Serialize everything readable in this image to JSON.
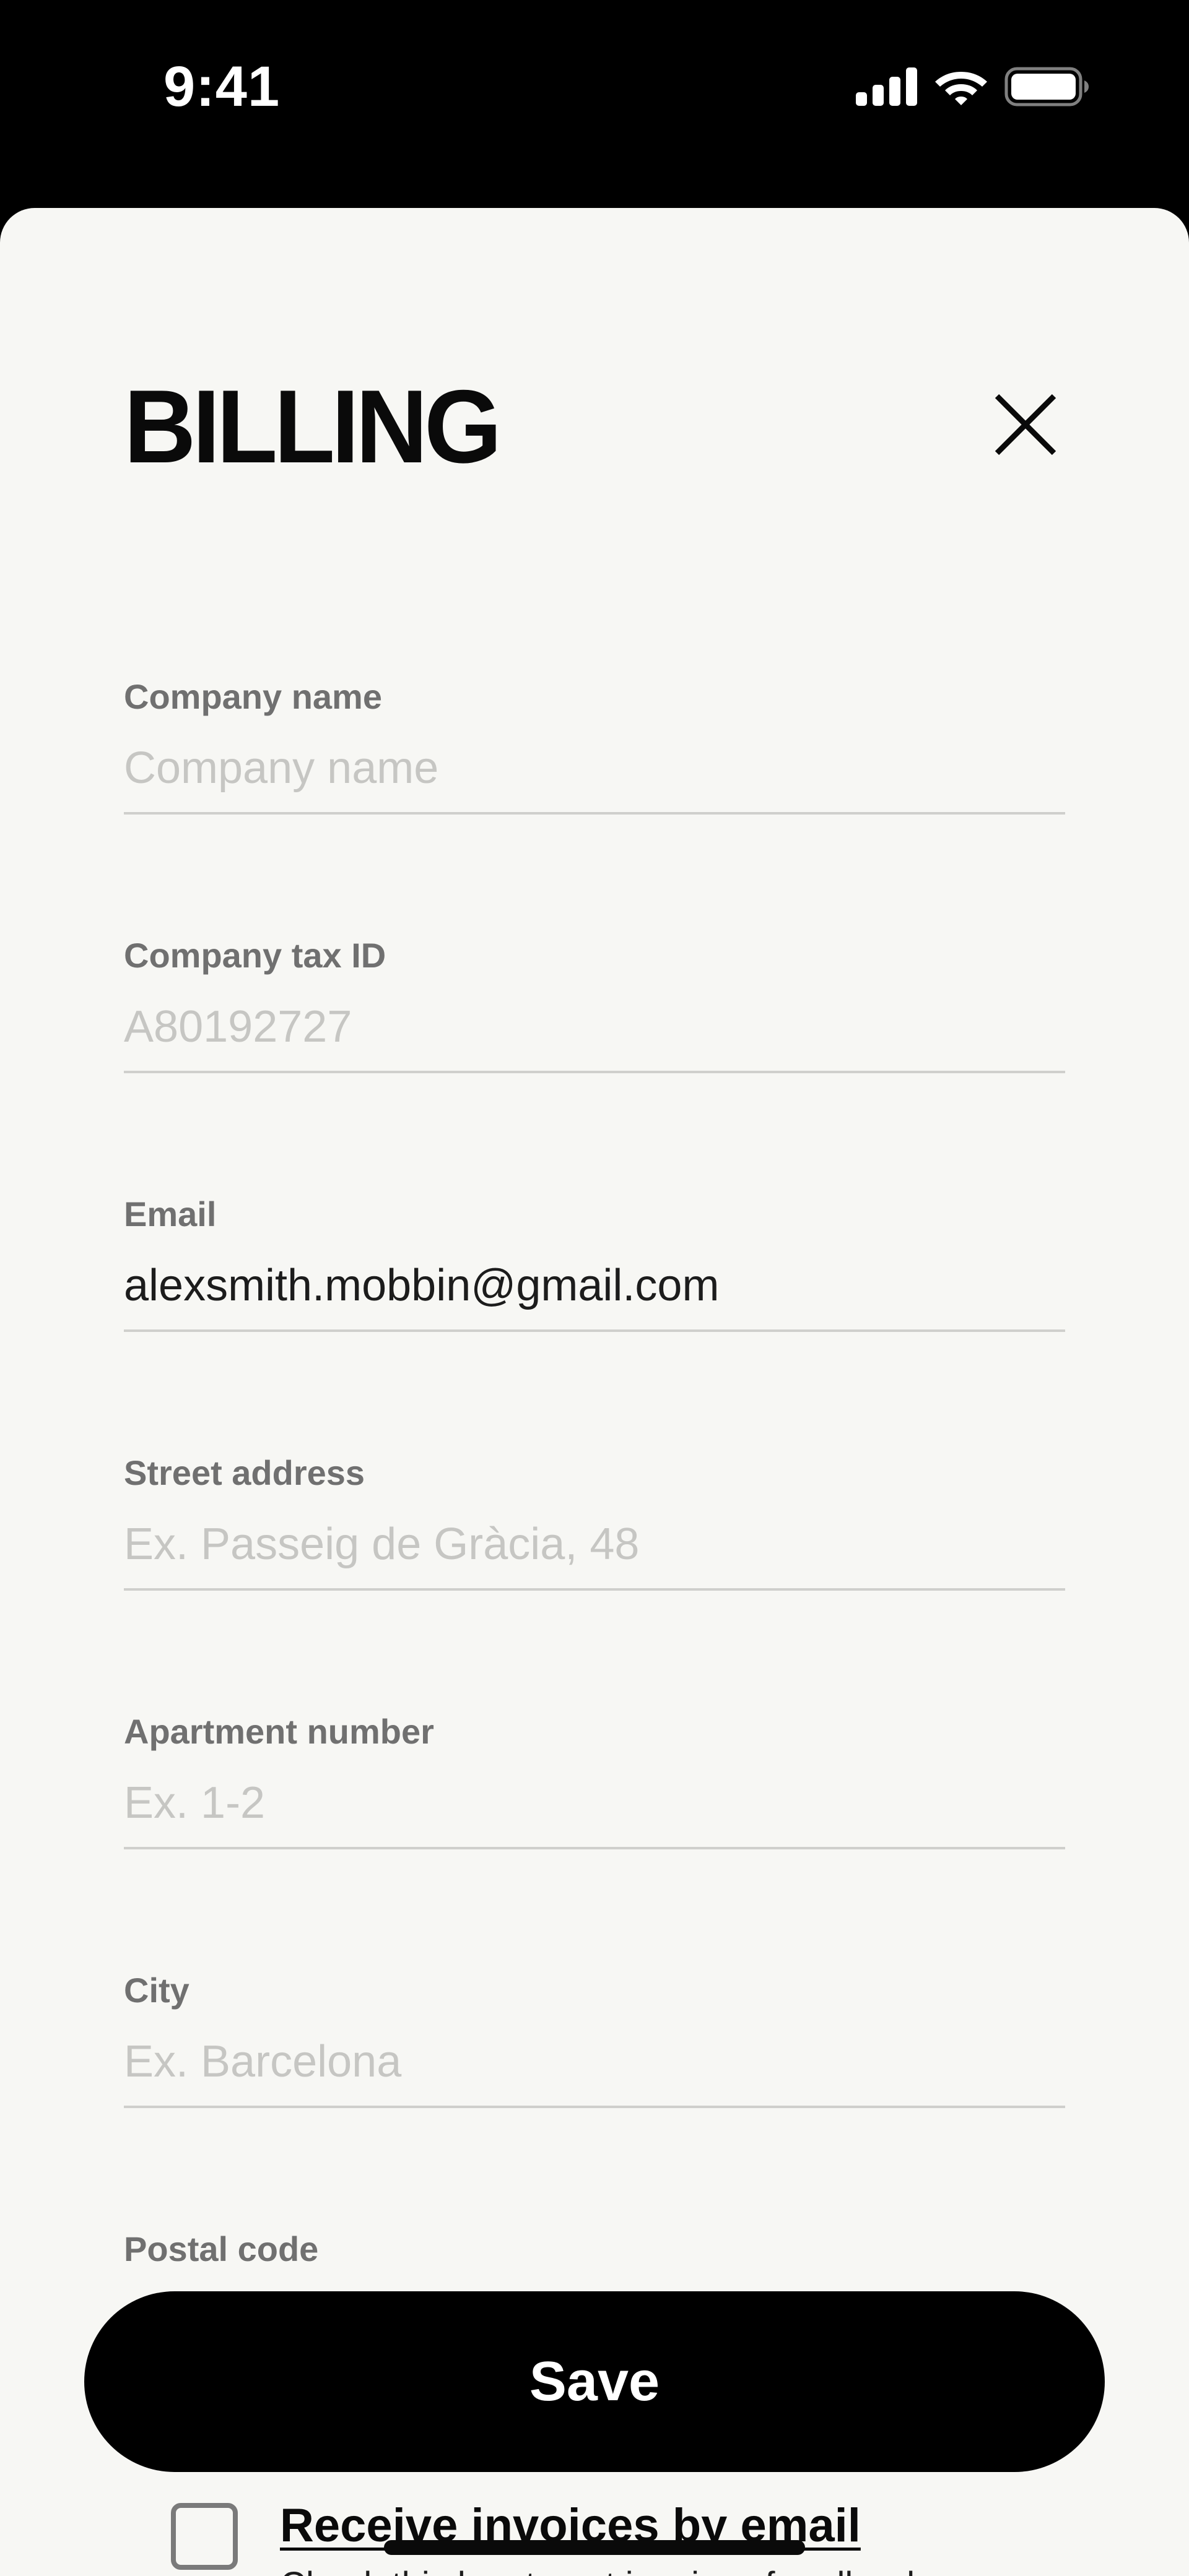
{
  "status_bar": {
    "time": "9:41",
    "icons": [
      "cellular-signal-icon",
      "wifi-icon",
      "battery-icon"
    ]
  },
  "sheet": {
    "title": "BILLING",
    "close_icon": "close-icon"
  },
  "fields": [
    {
      "label": "Company name",
      "value": "",
      "placeholder": "Company name"
    },
    {
      "label": "Company tax ID",
      "value": "",
      "placeholder": "A80192727"
    },
    {
      "label": "Email",
      "value": "alexsmith.mobbin@gmail.com",
      "placeholder": ""
    },
    {
      "label": "Street address",
      "value": "",
      "placeholder": "Ex. Passeig de Gràcia, 48"
    },
    {
      "label": "Apartment number",
      "value": "",
      "placeholder": "Ex. 1-2"
    },
    {
      "label": "City",
      "value": "",
      "placeholder": "Ex. Barcelona"
    },
    {
      "label": "Postal code",
      "value": "",
      "placeholder": ""
    }
  ],
  "save_button": {
    "label": "Save"
  },
  "invoices_option": {
    "title": "Receive invoices by email",
    "description": "Check this box to get invoices for all orders",
    "checked": false
  },
  "colors": {
    "background": "#f7f7f4",
    "primary": "#000000",
    "label": "#707070",
    "placeholder": "#c6c6c3",
    "divider": "#cfcfcc"
  }
}
